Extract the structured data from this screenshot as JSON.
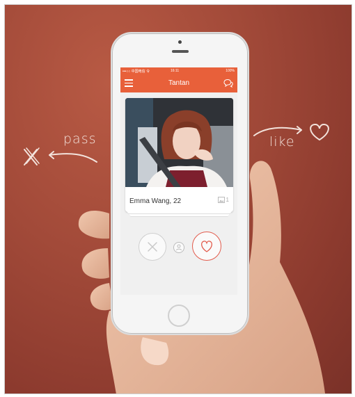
{
  "background": {
    "pass_label": "pass",
    "like_label": "like",
    "accent": "#a24a39"
  },
  "status_bar": {
    "carrier": "•••○○ 中国电信 令",
    "time": "16:11",
    "battery": "100%"
  },
  "app": {
    "title": "Tantan",
    "menu_icon": "hamburger-icon",
    "chat_icon": "chat-bubbles-icon",
    "accent": "#e8603a"
  },
  "profile_card": {
    "name": "Emma Wang, 22",
    "photo_count": "1"
  },
  "actions": {
    "pass_icon": "close-icon",
    "info_icon": "profile-icon",
    "like_icon": "heart-icon",
    "like_color": "#e25b4c"
  }
}
